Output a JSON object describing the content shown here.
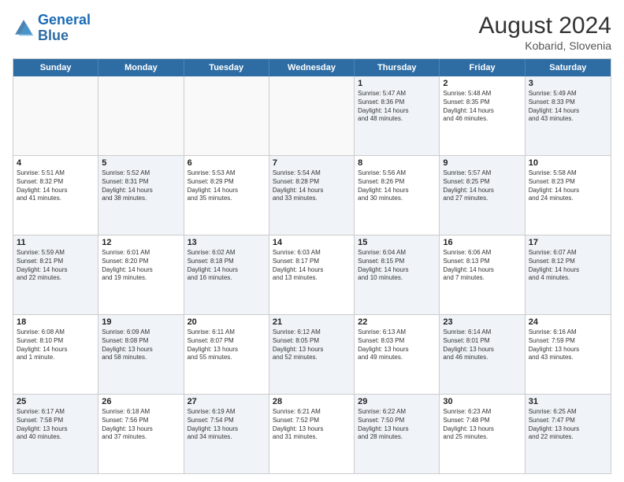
{
  "logo": {
    "line1": "General",
    "line2": "Blue"
  },
  "title": "August 2024",
  "subtitle": "Kobarid, Slovenia",
  "header_days": [
    "Sunday",
    "Monday",
    "Tuesday",
    "Wednesday",
    "Thursday",
    "Friday",
    "Saturday"
  ],
  "rows": [
    [
      {
        "day": "",
        "text": "",
        "empty": true
      },
      {
        "day": "",
        "text": "",
        "empty": true
      },
      {
        "day": "",
        "text": "",
        "empty": true
      },
      {
        "day": "",
        "text": "",
        "empty": true
      },
      {
        "day": "1",
        "text": "Sunrise: 5:47 AM\nSunset: 8:36 PM\nDaylight: 14 hours\nand 48 minutes.",
        "shaded": true
      },
      {
        "day": "2",
        "text": "Sunrise: 5:48 AM\nSunset: 8:35 PM\nDaylight: 14 hours\nand 46 minutes.",
        "shaded": false
      },
      {
        "day": "3",
        "text": "Sunrise: 5:49 AM\nSunset: 8:33 PM\nDaylight: 14 hours\nand 43 minutes.",
        "shaded": true
      }
    ],
    [
      {
        "day": "4",
        "text": "Sunrise: 5:51 AM\nSunset: 8:32 PM\nDaylight: 14 hours\nand 41 minutes.",
        "shaded": false
      },
      {
        "day": "5",
        "text": "Sunrise: 5:52 AM\nSunset: 8:31 PM\nDaylight: 14 hours\nand 38 minutes.",
        "shaded": true
      },
      {
        "day": "6",
        "text": "Sunrise: 5:53 AM\nSunset: 8:29 PM\nDaylight: 14 hours\nand 35 minutes.",
        "shaded": false
      },
      {
        "day": "7",
        "text": "Sunrise: 5:54 AM\nSunset: 8:28 PM\nDaylight: 14 hours\nand 33 minutes.",
        "shaded": true
      },
      {
        "day": "8",
        "text": "Sunrise: 5:56 AM\nSunset: 8:26 PM\nDaylight: 14 hours\nand 30 minutes.",
        "shaded": false
      },
      {
        "day": "9",
        "text": "Sunrise: 5:57 AM\nSunset: 8:25 PM\nDaylight: 14 hours\nand 27 minutes.",
        "shaded": true
      },
      {
        "day": "10",
        "text": "Sunrise: 5:58 AM\nSunset: 8:23 PM\nDaylight: 14 hours\nand 24 minutes.",
        "shaded": false
      }
    ],
    [
      {
        "day": "11",
        "text": "Sunrise: 5:59 AM\nSunset: 8:21 PM\nDaylight: 14 hours\nand 22 minutes.",
        "shaded": true
      },
      {
        "day": "12",
        "text": "Sunrise: 6:01 AM\nSunset: 8:20 PM\nDaylight: 14 hours\nand 19 minutes.",
        "shaded": false
      },
      {
        "day": "13",
        "text": "Sunrise: 6:02 AM\nSunset: 8:18 PM\nDaylight: 14 hours\nand 16 minutes.",
        "shaded": true
      },
      {
        "day": "14",
        "text": "Sunrise: 6:03 AM\nSunset: 8:17 PM\nDaylight: 14 hours\nand 13 minutes.",
        "shaded": false
      },
      {
        "day": "15",
        "text": "Sunrise: 6:04 AM\nSunset: 8:15 PM\nDaylight: 14 hours\nand 10 minutes.",
        "shaded": true
      },
      {
        "day": "16",
        "text": "Sunrise: 6:06 AM\nSunset: 8:13 PM\nDaylight: 14 hours\nand 7 minutes.",
        "shaded": false
      },
      {
        "day": "17",
        "text": "Sunrise: 6:07 AM\nSunset: 8:12 PM\nDaylight: 14 hours\nand 4 minutes.",
        "shaded": true
      }
    ],
    [
      {
        "day": "18",
        "text": "Sunrise: 6:08 AM\nSunset: 8:10 PM\nDaylight: 14 hours\nand 1 minute.",
        "shaded": false
      },
      {
        "day": "19",
        "text": "Sunrise: 6:09 AM\nSunset: 8:08 PM\nDaylight: 13 hours\nand 58 minutes.",
        "shaded": true
      },
      {
        "day": "20",
        "text": "Sunrise: 6:11 AM\nSunset: 8:07 PM\nDaylight: 13 hours\nand 55 minutes.",
        "shaded": false
      },
      {
        "day": "21",
        "text": "Sunrise: 6:12 AM\nSunset: 8:05 PM\nDaylight: 13 hours\nand 52 minutes.",
        "shaded": true
      },
      {
        "day": "22",
        "text": "Sunrise: 6:13 AM\nSunset: 8:03 PM\nDaylight: 13 hours\nand 49 minutes.",
        "shaded": false
      },
      {
        "day": "23",
        "text": "Sunrise: 6:14 AM\nSunset: 8:01 PM\nDaylight: 13 hours\nand 46 minutes.",
        "shaded": true
      },
      {
        "day": "24",
        "text": "Sunrise: 6:16 AM\nSunset: 7:59 PM\nDaylight: 13 hours\nand 43 minutes.",
        "shaded": false
      }
    ],
    [
      {
        "day": "25",
        "text": "Sunrise: 6:17 AM\nSunset: 7:58 PM\nDaylight: 13 hours\nand 40 minutes.",
        "shaded": true
      },
      {
        "day": "26",
        "text": "Sunrise: 6:18 AM\nSunset: 7:56 PM\nDaylight: 13 hours\nand 37 minutes.",
        "shaded": false
      },
      {
        "day": "27",
        "text": "Sunrise: 6:19 AM\nSunset: 7:54 PM\nDaylight: 13 hours\nand 34 minutes.",
        "shaded": true
      },
      {
        "day": "28",
        "text": "Sunrise: 6:21 AM\nSunset: 7:52 PM\nDaylight: 13 hours\nand 31 minutes.",
        "shaded": false
      },
      {
        "day": "29",
        "text": "Sunrise: 6:22 AM\nSunset: 7:50 PM\nDaylight: 13 hours\nand 28 minutes.",
        "shaded": true
      },
      {
        "day": "30",
        "text": "Sunrise: 6:23 AM\nSunset: 7:48 PM\nDaylight: 13 hours\nand 25 minutes.",
        "shaded": false
      },
      {
        "day": "31",
        "text": "Sunrise: 6:25 AM\nSunset: 7:47 PM\nDaylight: 13 hours\nand 22 minutes.",
        "shaded": true
      }
    ]
  ]
}
